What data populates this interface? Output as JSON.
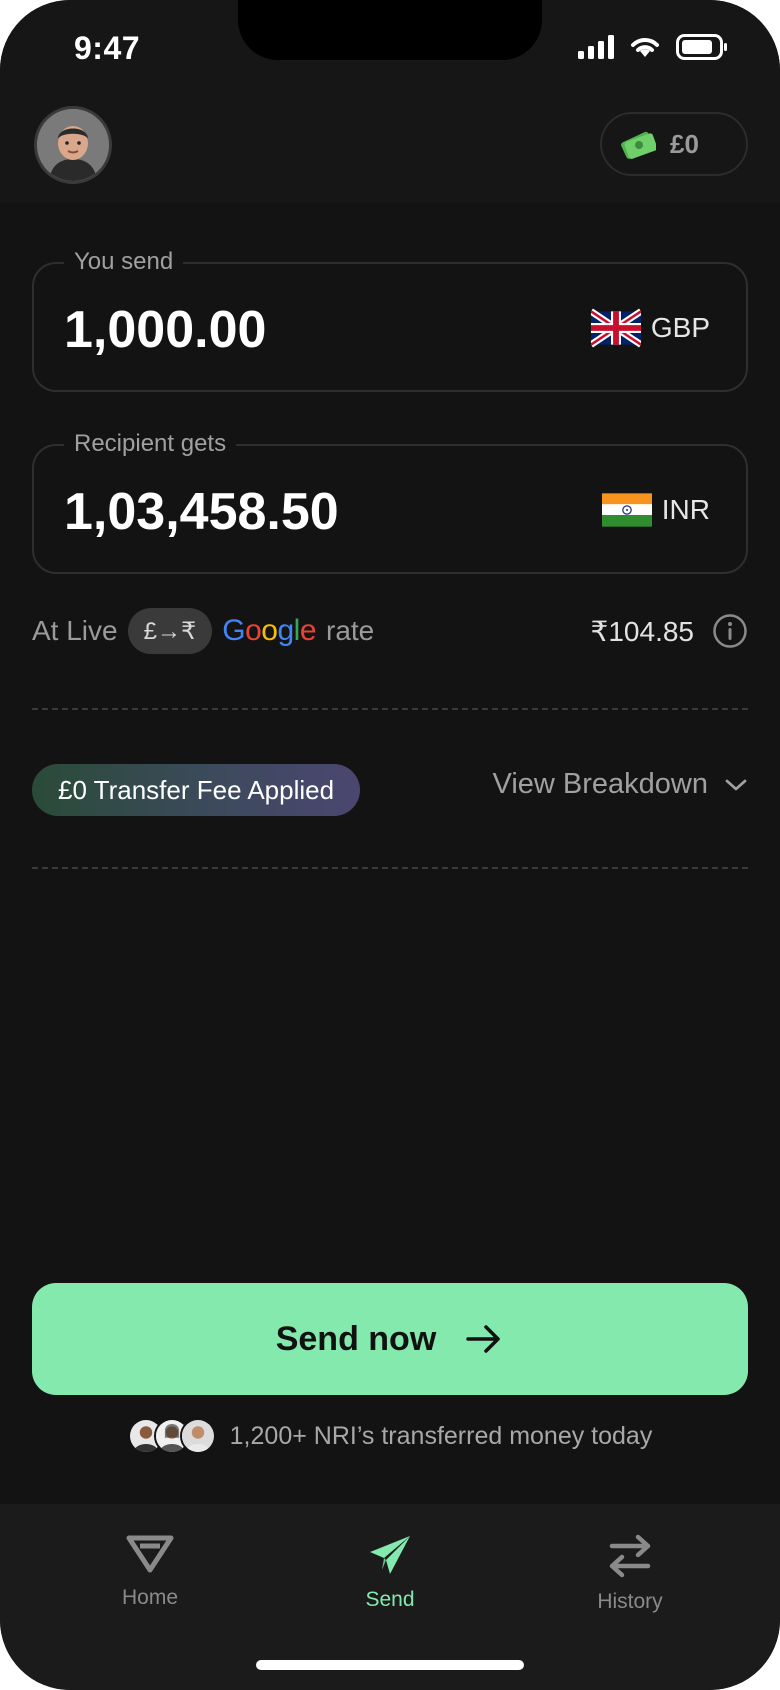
{
  "status_bar": {
    "time": "9:47"
  },
  "header": {
    "wallet_balance": "£0"
  },
  "send_field": {
    "label": "You send",
    "amount": "1,000.00",
    "currency": "GBP"
  },
  "receive_field": {
    "label": "Recipient gets",
    "amount": "1,03,458.50",
    "currency": "INR"
  },
  "rate": {
    "prefix": "At Live",
    "pair": "£→₹",
    "source": "Google",
    "suffix": "rate",
    "value": "₹104.85"
  },
  "fee": {
    "badge": "£0 Transfer Fee Applied",
    "breakdown_label": "View Breakdown"
  },
  "cta": {
    "label": "Send now"
  },
  "social_proof": {
    "text": "1,200+ NRI’s transferred money today"
  },
  "tabs": [
    {
      "label": "Home",
      "icon": "home-logo-icon",
      "active": false
    },
    {
      "label": "Send",
      "icon": "paper-plane-icon",
      "active": true
    },
    {
      "label": "History",
      "icon": "swap-arrows-icon",
      "active": false
    }
  ],
  "colors": {
    "accent": "#84e9ad",
    "background": "#131313",
    "fee_gradient_start": "#2a4b38",
    "fee_gradient_end": "#4b4670"
  }
}
